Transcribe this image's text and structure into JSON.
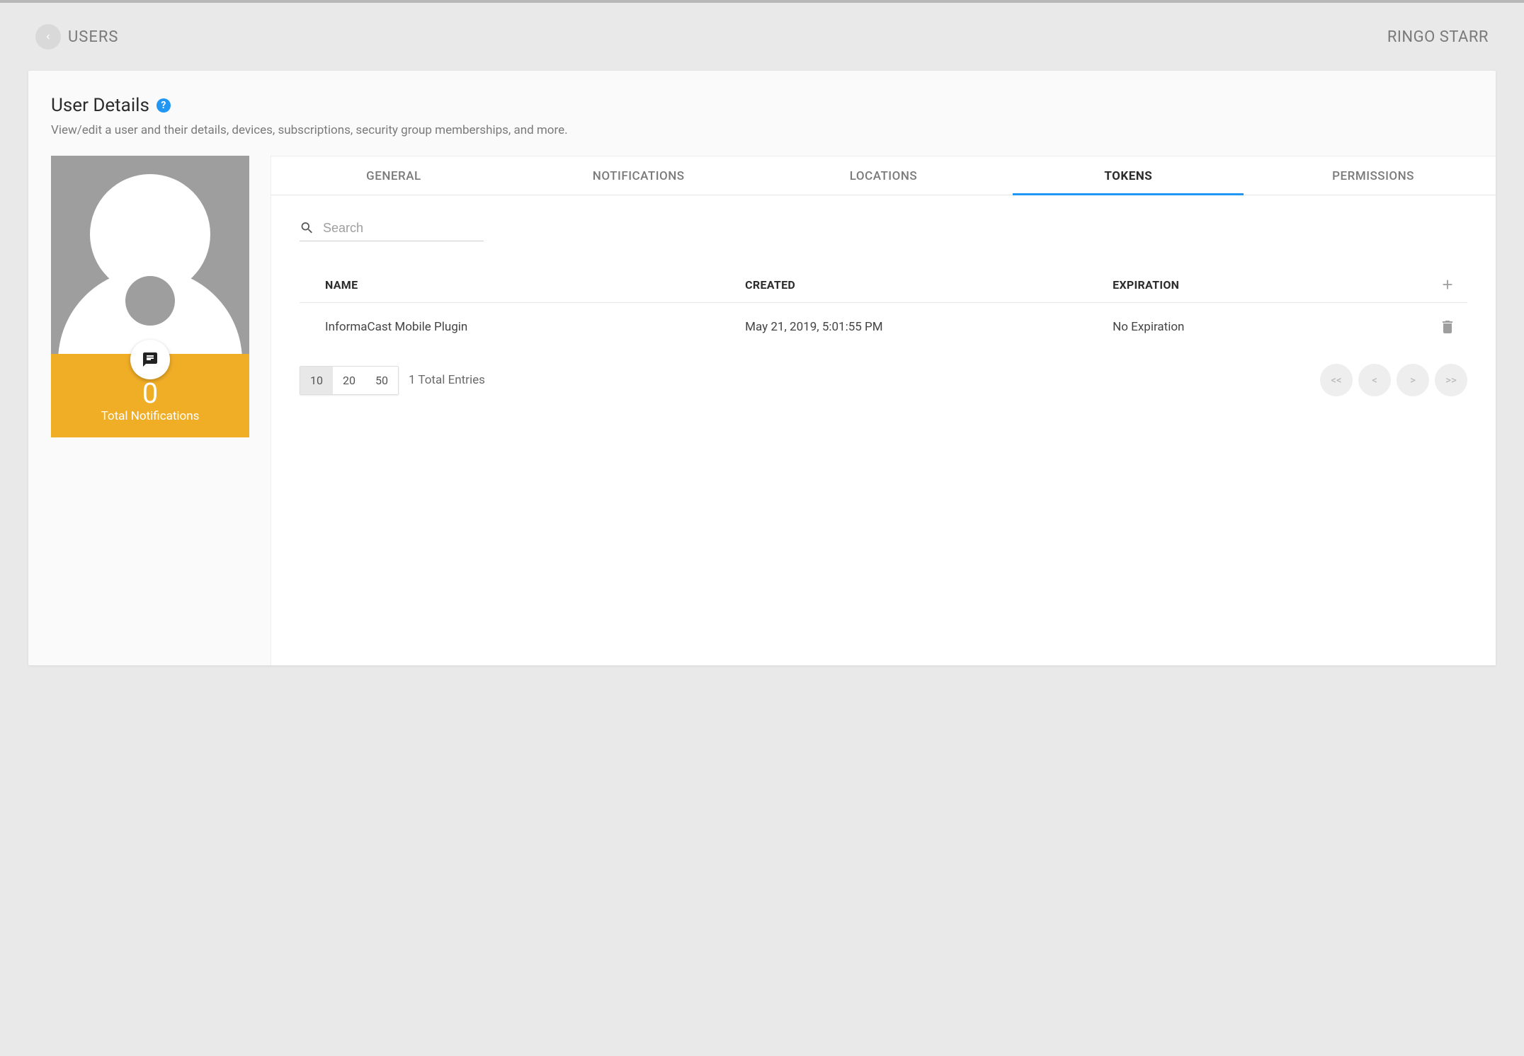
{
  "breadcrumb": {
    "label": "USERS"
  },
  "currentUser": "RINGO STARR",
  "header": {
    "title": "User Details",
    "subtitle": "View/edit a user and their details, devices, subscriptions, security group memberships, and more."
  },
  "profile": {
    "notifications_count": "0",
    "notifications_label": "Total Notifications"
  },
  "tabs": [
    {
      "id": "general",
      "label": "GENERAL",
      "active": false
    },
    {
      "id": "notifications",
      "label": "NOTIFICATIONS",
      "active": false
    },
    {
      "id": "locations",
      "label": "LOCATIONS",
      "active": false
    },
    {
      "id": "tokens",
      "label": "TOKENS",
      "active": true
    },
    {
      "id": "permissions",
      "label": "PERMISSIONS",
      "active": false
    }
  ],
  "search": {
    "placeholder": "Search",
    "value": ""
  },
  "table": {
    "columns": {
      "name": "NAME",
      "created": "CREATED",
      "expiration": "EXPIRATION"
    },
    "rows": [
      {
        "name": "InformaCast Mobile Plugin",
        "created": "May 21, 2019, 5:01:55 PM",
        "expiration": "No Expiration"
      }
    ]
  },
  "pagination": {
    "sizes": [
      "10",
      "20",
      "50"
    ],
    "selected": "10",
    "total_label": "1 Total Entries",
    "nav": {
      "first": "<<",
      "prev": "<",
      "next": ">",
      "last": ">>"
    }
  },
  "help_glyph": "?"
}
